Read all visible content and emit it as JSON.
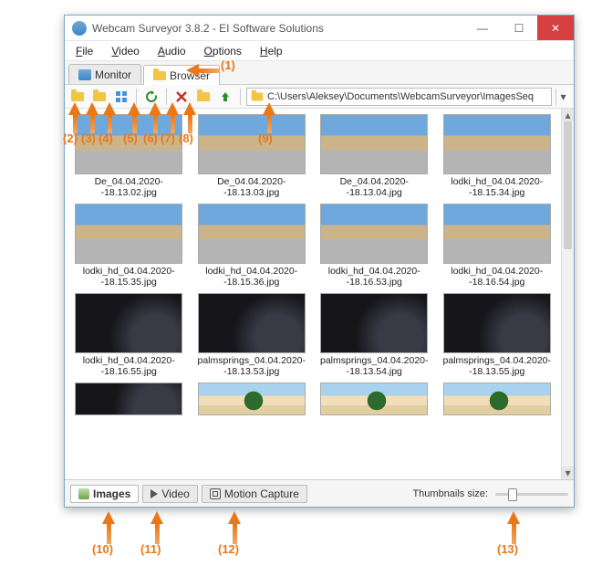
{
  "window": {
    "title": "Webcam Surveyor 3.8.2 - EI Software Solutions"
  },
  "menubar": {
    "items": [
      "File",
      "Video",
      "Audio",
      "Options",
      "Help"
    ]
  },
  "tabs": {
    "monitor": "Monitor",
    "browser": "Browser"
  },
  "toolbar": {
    "path": "C:\\Users\\Aleksey\\Documents\\WebcamSurveyor\\ImagesSeq",
    "icons": {
      "open_folder": "open-folder-icon",
      "open_recent": "open-recent-folder-icon",
      "views": "views-icon",
      "refresh": "refresh-icon",
      "delete": "delete-icon",
      "new_folder": "new-folder-icon",
      "up": "up-folder-icon",
      "home": "home-icon"
    }
  },
  "thumbnails": [
    {
      "name": "De_04.04.2020--18.13.02.jpg",
      "kind": "beach"
    },
    {
      "name": "De_04.04.2020--18.13.03.jpg",
      "kind": "beach"
    },
    {
      "name": "De_04.04.2020--18.13.04.jpg",
      "kind": "beach"
    },
    {
      "name": "lodki_hd_04.04.2020--18.15.34.jpg",
      "kind": "beach"
    },
    {
      "name": "lodki_hd_04.04.2020--18.15.35.jpg",
      "kind": "beach"
    },
    {
      "name": "lodki_hd_04.04.2020--18.15.36.jpg",
      "kind": "beach"
    },
    {
      "name": "lodki_hd_04.04.2020--18.16.53.jpg",
      "kind": "beach"
    },
    {
      "name": "lodki_hd_04.04.2020--18.16.54.jpg",
      "kind": "beach"
    },
    {
      "name": "lodki_hd_04.04.2020--18.16.55.jpg",
      "kind": "dark"
    },
    {
      "name": "palmsprings_04.04.2020--18.13.53.jpg",
      "kind": "dark"
    },
    {
      "name": "palmsprings_04.04.2020--18.13.54.jpg",
      "kind": "dark"
    },
    {
      "name": "palmsprings_04.04.2020--18.13.55.jpg",
      "kind": "dark"
    },
    {
      "name": "",
      "kind": "dark"
    },
    {
      "name": "",
      "kind": "palm"
    },
    {
      "name": "",
      "kind": "palm"
    },
    {
      "name": "",
      "kind": "palm"
    }
  ],
  "footer": {
    "images_tab": "Images",
    "video_tab": "Video",
    "motion_tab": "Motion Capture",
    "thumb_size_label": "Thumbnails size:"
  },
  "annotations": {
    "1": "(1)",
    "2": "(2)",
    "3": "(3)",
    "4": "(4)",
    "5": "(5)",
    "6": "(6)",
    "7": "(7)",
    "8": "(8)",
    "9": "(9)",
    "10": "(10)",
    "11": "(11)",
    "12": "(12)",
    "13": "(13)"
  }
}
